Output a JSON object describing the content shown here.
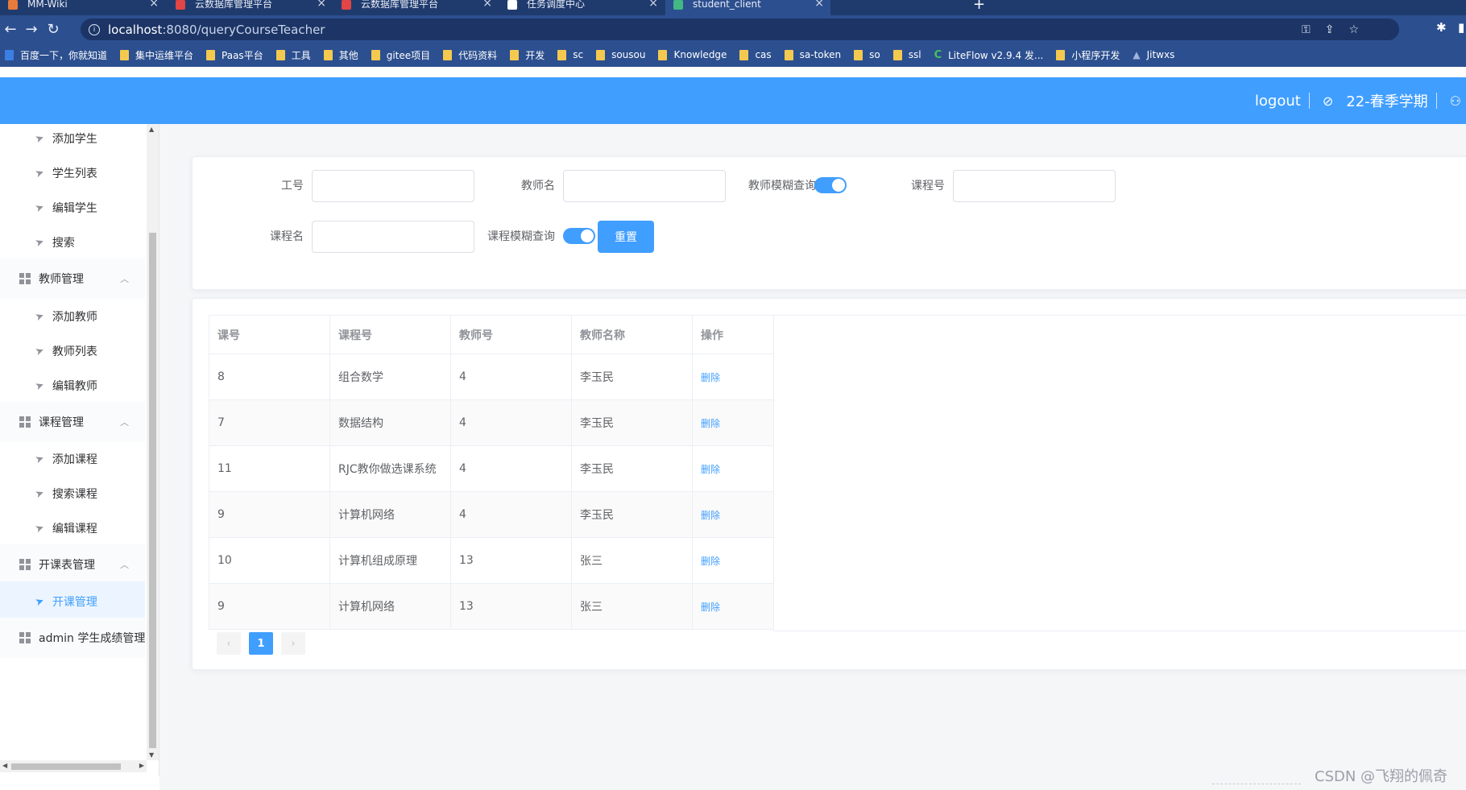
{
  "browser": {
    "tabs": [
      {
        "title": "MM-Wiki",
        "close": "×",
        "color": "#e87a3c",
        "active": false
      },
      {
        "title": "云数据库管理平台",
        "close": "×",
        "color": "#e14545",
        "active": false
      },
      {
        "title": "云数据库管理平台",
        "close": "×",
        "color": "#e14545",
        "active": false
      },
      {
        "title": "任务调度中心",
        "close": "×",
        "color": "#ffffff",
        "active": false
      },
      {
        "title": "student_client",
        "close": "×",
        "color": "#42b883",
        "active": true
      }
    ],
    "new_tab": "+",
    "url_host": "localhost",
    "url_path": ":8080/queryCourseTeacher",
    "bookmarks": [
      {
        "label": "百度一下，你就知道",
        "icon": "blue"
      },
      {
        "label": "集中运维平台",
        "icon": "folder"
      },
      {
        "label": "Paas平台",
        "icon": "folder"
      },
      {
        "label": "工具",
        "icon": "folder"
      },
      {
        "label": "其他",
        "icon": "folder"
      },
      {
        "label": "gitee项目",
        "icon": "folder"
      },
      {
        "label": "代码资料",
        "icon": "folder"
      },
      {
        "label": "开发",
        "icon": "folder"
      },
      {
        "label": "sc",
        "icon": "folder"
      },
      {
        "label": "sousou",
        "icon": "folder"
      },
      {
        "label": "Knowledge",
        "icon": "folder"
      },
      {
        "label": "cas",
        "icon": "folder"
      },
      {
        "label": "sa-token",
        "icon": "folder"
      },
      {
        "label": "so",
        "icon": "folder"
      },
      {
        "label": "ssl",
        "icon": "folder"
      },
      {
        "label": "LiteFlow v2.9.4 发...",
        "icon": "green"
      },
      {
        "label": "小程序开发",
        "icon": "folder"
      },
      {
        "label": "Jitwxs",
        "icon": "nav"
      }
    ]
  },
  "header": {
    "logout": "logout",
    "semester": "22-春季学期"
  },
  "sidebar": {
    "items": [
      {
        "label": "添加学生",
        "type": "sub",
        "active": false
      },
      {
        "label": "学生列表",
        "type": "sub",
        "active": false
      },
      {
        "label": "编辑学生",
        "type": "sub",
        "active": false
      },
      {
        "label": "搜索",
        "type": "sub",
        "active": false
      },
      {
        "label": "教师管理",
        "type": "group",
        "active": false
      },
      {
        "label": "添加教师",
        "type": "sub",
        "active": false
      },
      {
        "label": "教师列表",
        "type": "sub",
        "active": false
      },
      {
        "label": "编辑教师",
        "type": "sub",
        "active": false
      },
      {
        "label": "课程管理",
        "type": "group",
        "active": false
      },
      {
        "label": "添加课程",
        "type": "sub",
        "active": false
      },
      {
        "label": "搜索课程",
        "type": "sub",
        "active": false
      },
      {
        "label": "编辑课程",
        "type": "sub",
        "active": false
      },
      {
        "label": "开课表管理",
        "type": "group",
        "active": false
      },
      {
        "label": "开课管理",
        "type": "sub",
        "active": true
      },
      {
        "label": "admin 学生成绩管理",
        "type": "group-nochev",
        "active": false
      }
    ]
  },
  "search": {
    "label_teacher_id": "工号",
    "label_teacher_name": "教师名",
    "label_teacher_fuzzy": "教师模糊查询",
    "label_course_id": "课程号",
    "label_course_name": "课程名",
    "label_course_fuzzy": "课程模糊查询",
    "teacher_fuzzy_on": true,
    "course_fuzzy_on": true,
    "reset_button": "重置",
    "teacher_id_value": "",
    "teacher_name_value": "",
    "course_id_value": "",
    "course_name_value": ""
  },
  "table": {
    "columns": [
      "课号",
      "课程号",
      "教师号",
      "教师名称",
      "操作"
    ],
    "rows": [
      [
        "8",
        "组合数学",
        "4",
        "李玉民",
        "删除"
      ],
      [
        "7",
        "数据结构",
        "4",
        "李玉民",
        "删除"
      ],
      [
        "11",
        "RJC教你做选课系统",
        "4",
        "李玉民",
        "删除"
      ],
      [
        "9",
        "计算机网络",
        "4",
        "李玉民",
        "删除"
      ],
      [
        "10",
        "计算机组成原理",
        "13",
        "张三",
        "删除"
      ],
      [
        "9",
        "计算机网络",
        "13",
        "张三",
        "删除"
      ]
    ]
  },
  "pagination": {
    "prev": "‹",
    "current": "1",
    "next": "›"
  },
  "watermark": "CSDN @飞翔的佩奇",
  "colors": {
    "primary": "#409eff",
    "browser_chrome": "#2c4f8f"
  }
}
